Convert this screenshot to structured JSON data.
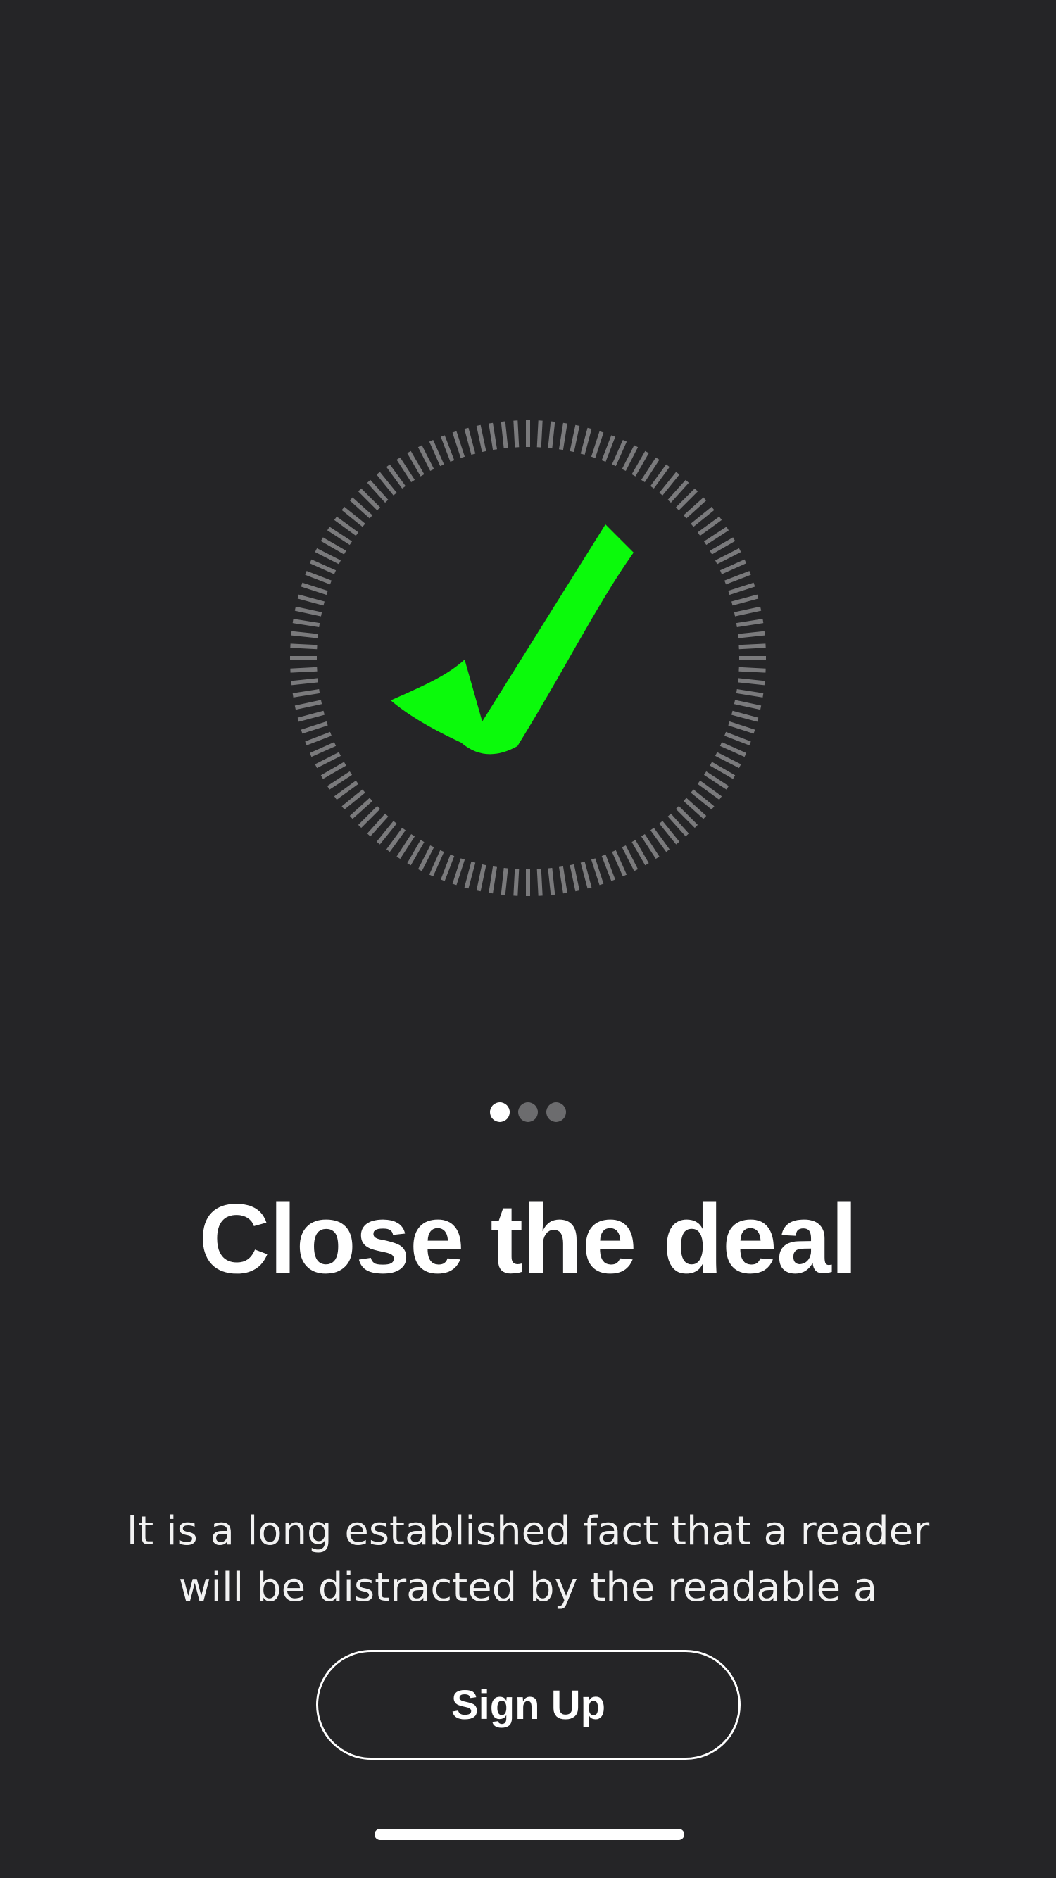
{
  "hero": {
    "icon": "checkmark-icon",
    "check_color": "#0bfa0b",
    "ring_color": "#7a7a7c"
  },
  "pager": {
    "total": 3,
    "current": 1
  },
  "title": "Close the deal",
  "description": "It is a long established fact that a reader will be distracted by the readable a",
  "signup_button": {
    "label": "Sign Up"
  },
  "colors": {
    "background": "#252527",
    "text": "#ffffff",
    "dot_inactive": "#6c6c6e"
  }
}
